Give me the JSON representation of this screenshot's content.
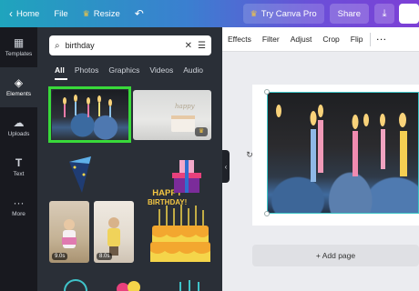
{
  "topbar": {
    "home_label": "Home",
    "file_label": "File",
    "resize_label": "Resize",
    "try_pro_label": "Try Canva Pro",
    "share_label": "Share"
  },
  "rail": {
    "items": [
      {
        "label": "Templates",
        "icon": "templates-icon"
      },
      {
        "label": "Elements",
        "icon": "elements-icon"
      },
      {
        "label": "Uploads",
        "icon": "uploads-icon"
      },
      {
        "label": "Text",
        "icon": "text-icon"
      },
      {
        "label": "More",
        "icon": "more-icon"
      }
    ]
  },
  "search": {
    "value": "birthday"
  },
  "tabs": [
    "All",
    "Photos",
    "Graphics",
    "Videos",
    "Audio"
  ],
  "results": {
    "happy_line1": "HAPPY",
    "happy_line2": "BIRTHDAY!",
    "video1_duration": "9.0s",
    "video2_duration": "8.0s"
  },
  "context_bar": {
    "effects": "Effects",
    "filter": "Filter",
    "adjust": "Adjust",
    "crop": "Crop",
    "flip": "Flip"
  },
  "canvas": {
    "add_page_label": "+ Add page"
  },
  "colors": {
    "accent_green": "#39d93a",
    "panel_bg": "#2a2f37",
    "rail_bg": "#18191f"
  }
}
